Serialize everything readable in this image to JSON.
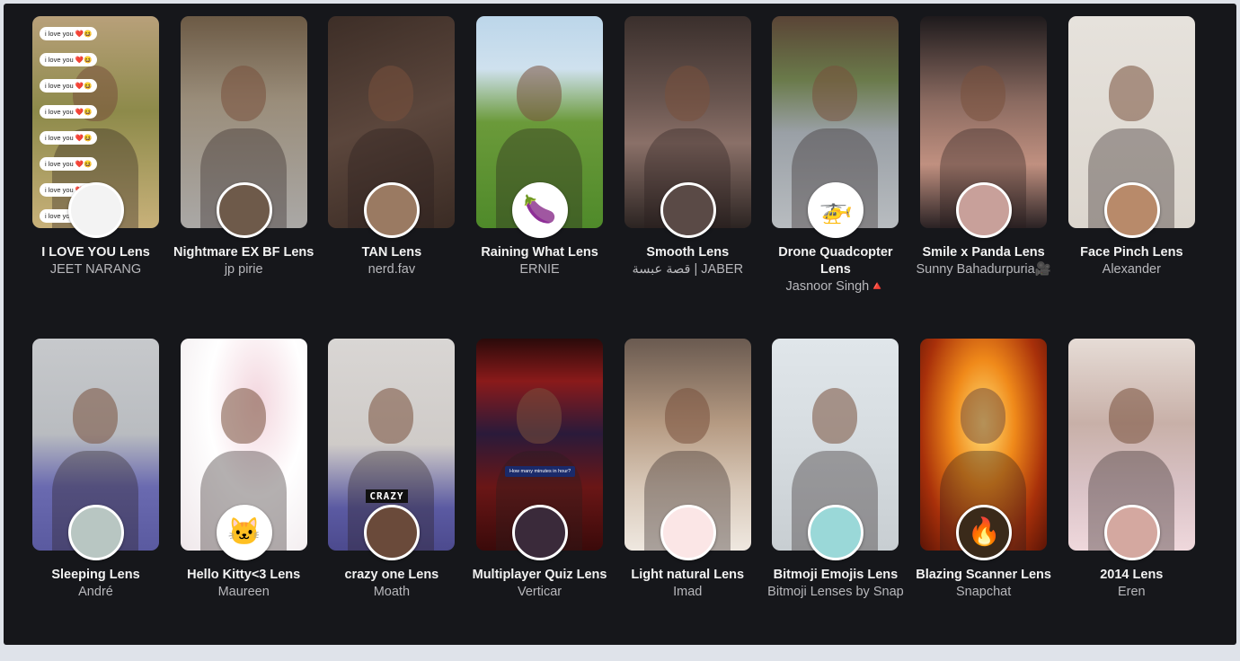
{
  "lenses": [
    {
      "title": "I LOVE YOU Lens",
      "creator": "JEET NARANG",
      "thumb_bg": "linear-gradient(180deg,#b8a07a 0%,#8d8a4a 45%,#c8b17a 100%)",
      "badge_bg": "#f3f3f3",
      "bubble_text": "i love you ❤️😆"
    },
    {
      "title": "Nightmare EX BF Lens",
      "creator": "jp pirie",
      "thumb_bg": "linear-gradient(180deg,#6c5a45 0%,#9a8d7a 40%,#aaa8a6 100%)",
      "badge_bg": "#6e5a4a"
    },
    {
      "title": "TAN Lens",
      "creator": "nerd.fav",
      "thumb_bg": "linear-gradient(160deg,#3d2e27 0%,#5b463c 50%,#3a2b24 100%)",
      "badge_bg": "#9a7a62"
    },
    {
      "title": "Raining What Lens",
      "creator": "ERNIE",
      "thumb_bg": "linear-gradient(180deg,#bcd6ea 0%,#cfe1ee 25%,#6b9a3a 50%,#4f8a2a 100%)",
      "badge_bg": "#ffffff",
      "badge_glyph": "🍆"
    },
    {
      "title": "Smooth Lens",
      "creator": "قصة عبسة | JABER",
      "thumb_bg": "linear-gradient(180deg,#3a2f2c 0%,#6a5650 40%,#8a7068 60%,#2c2422 100%)",
      "badge_bg": "#5a4a46"
    },
    {
      "title": "Drone Quadcopter Lens",
      "creator": "Jasnoor Singh🔺",
      "thumb_bg": "linear-gradient(180deg,#5a4436 0%,#6a7a4a 30%,#9aa0a6 55%,#b8bcc0 100%)",
      "badge_bg": "#ffffff",
      "badge_glyph": "🚁"
    },
    {
      "title": "Smile x Panda Lens",
      "creator": "Sunny Bahadurpuria🎥",
      "thumb_bg": "linear-gradient(180deg,#1e1a1c 0%,#8a6a60 40%,#c09080 70%,#2a2224 100%)",
      "badge_bg": "#c8a09a"
    },
    {
      "title": "Face Pinch Lens",
      "creator": "Alexander",
      "thumb_bg": "linear-gradient(180deg,#e6e2dc 0%,#dcd6ce 100%)",
      "badge_bg": "#b88a6a"
    },
    {
      "title": "Sleeping Lens",
      "creator": "André",
      "thumb_bg": "linear-gradient(180deg,#c7c9cc 0%,#b9bcc0 45%,#6a6ab0 70%,#5a5aa0 100%)",
      "badge_bg": "#b8c6c2"
    },
    {
      "title": "Hello Kitty<3 Lens",
      "creator": "Maureen",
      "thumb_bg": "radial-gradient(ellipse at 60% 30%,#f3d6de 0%,#ffffff 45%,#efe7ea 100%)",
      "badge_bg": "#ffffff",
      "badge_glyph": "🐱"
    },
    {
      "title": "crazy one Lens",
      "creator": "Moath",
      "thumb_bg": "linear-gradient(180deg,#d9d6d4 0%,#cfcbc8 50%,#5b5aa2 80%,#4c4a8e 100%)",
      "badge_bg": "#6a4a3a",
      "sticker_text": "CRAZY"
    },
    {
      "title": "Multiplayer Quiz Lens",
      "creator": "Verticar",
      "thumb_bg": "linear-gradient(180deg,#2a0a0a 0%,#8a1a1a 20%,#2a1a3a 45%,#6a1616 70%,#3a0a0a 100%)",
      "badge_bg": "#3a2a3a",
      "quiz_text": "How many minutes in hour?"
    },
    {
      "title": "Light natural Lens",
      "creator": "Imad",
      "thumb_bg": "linear-gradient(180deg,#6a5a50 0%,#b59a82 40%,#d8c8b8 70%,#efe8e0 100%)",
      "badge_bg": "#fbe6e6"
    },
    {
      "title": "Bitmoji Emojis Lens",
      "creator": "Bitmoji Lenses by Snap",
      "thumb_bg": "linear-gradient(180deg,#e0e6ea 0%,#d6dce0 50%,#c8ced2 100%)",
      "badge_bg": "#9ad8d8"
    },
    {
      "title": "Blazing Scanner Lens",
      "creator": "Snapchat",
      "thumb_bg": "radial-gradient(ellipse at 50% 40%,#ffe07a 0%,#f08a1a 35%,#a8300a 70%,#5a1406 100%)",
      "badge_bg": "#3a2a1a",
      "badge_glyph": "🔥"
    },
    {
      "title": "2014 Lens",
      "creator": "Eren",
      "thumb_bg": "linear-gradient(180deg,#e6dcd6 0%,#c8b0a8 40%,#d9c2c6 70%,#efd8dc 100%)",
      "badge_bg": "#d4a8a0"
    }
  ]
}
